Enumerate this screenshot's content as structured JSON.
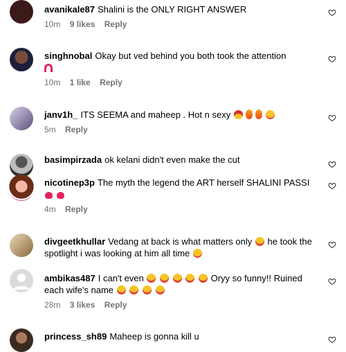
{
  "comments": [
    {
      "username": "avanikale87",
      "text": "Shalini is the ONLY RIGHT ANSWER",
      "time": "10m",
      "likes": "9 likes",
      "reply": "Reply"
    },
    {
      "username": "singhnobal",
      "text": "Okay but ved behind you both took the attention",
      "time": "10m",
      "likes": "1 like",
      "reply": "Reply"
    },
    {
      "username": "janv1h_",
      "text": "ITS SEEMA and maheep . Hot n sexy",
      "time": "5m",
      "likes": "",
      "reply": "Reply"
    },
    {
      "username": "basimpirzada",
      "text": "ok kelani didn't even make the cut",
      "time": "",
      "likes": "",
      "reply": ""
    },
    {
      "username": "nicotinep3p",
      "text": "The myth the legend the ART herself SHALINI PASSI",
      "time": "4m",
      "likes": "",
      "reply": "Reply"
    },
    {
      "username": "divgeetkhullar",
      "text": "Vedang at back is what matters only",
      "text2": "he took the spotlight i was looking at him all time",
      "time": "",
      "likes": "",
      "reply": ""
    },
    {
      "username": "ambikas487",
      "text": "I can't even",
      "text2": "Oryy so funny!! Ruined each wife's name",
      "time": "28m",
      "likes": "3 likes",
      "reply": "Reply"
    },
    {
      "username": "princess_sh89",
      "text": "Maheep is gonna kill u",
      "time": "",
      "likes": "",
      "reply": ""
    }
  ],
  "icons": {
    "like": "heart-outline-icon"
  }
}
